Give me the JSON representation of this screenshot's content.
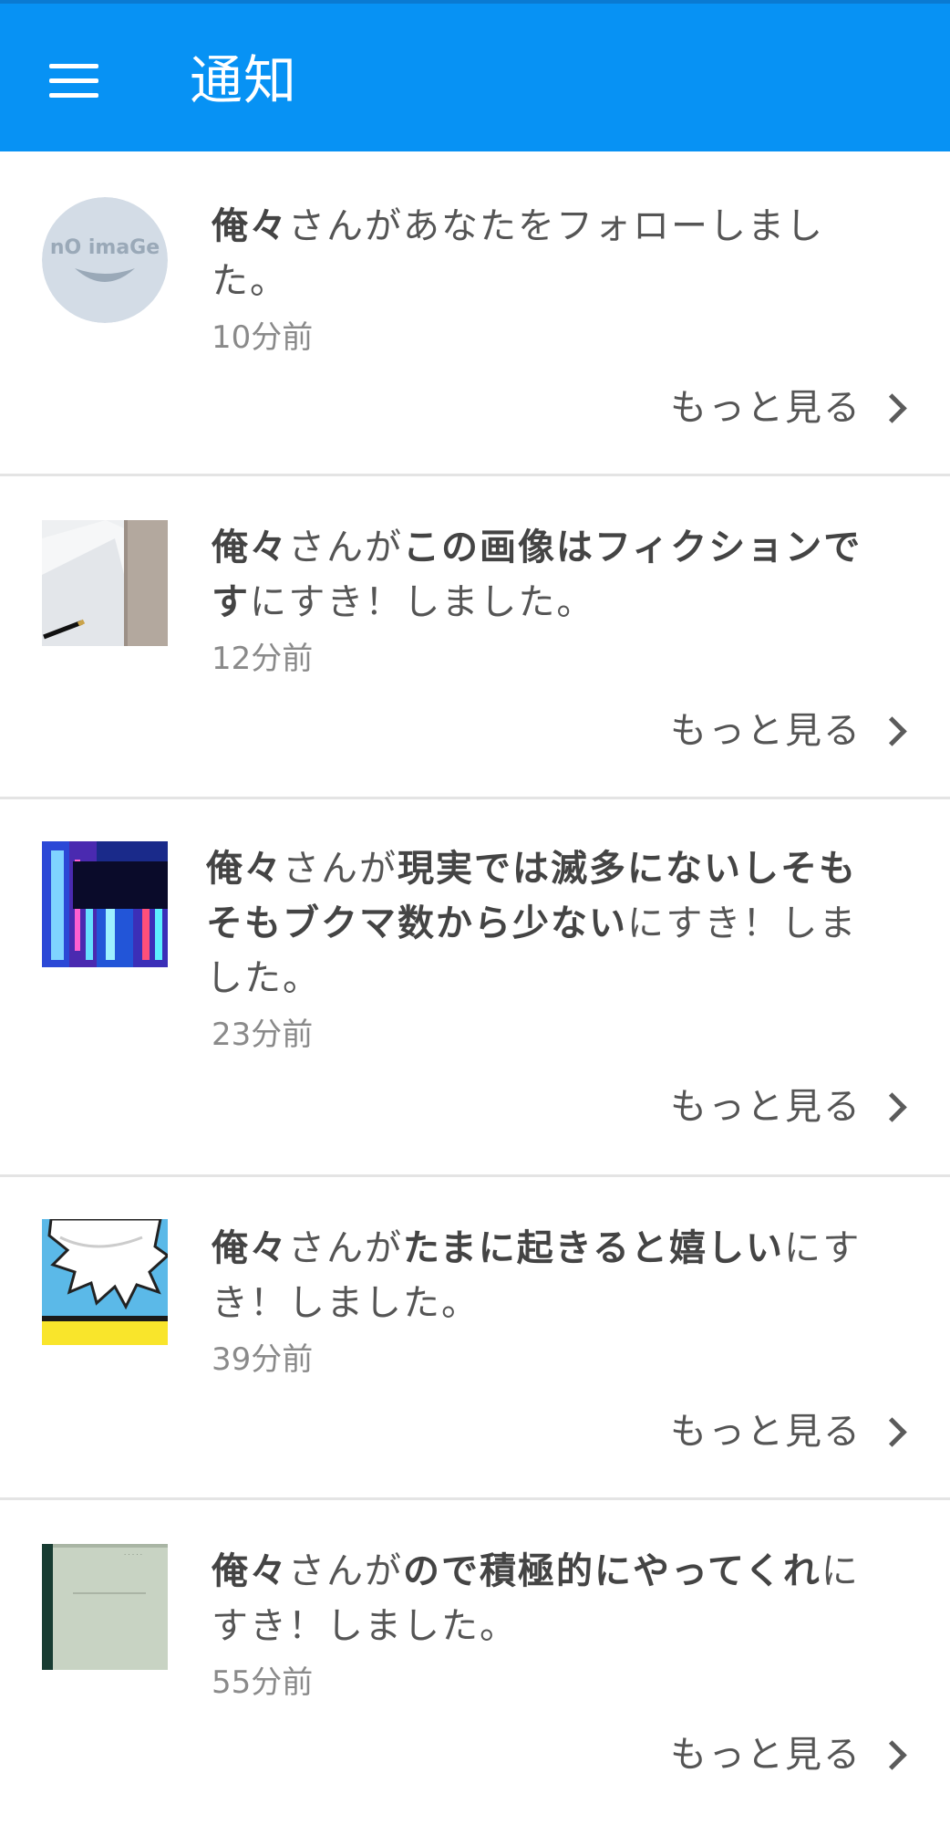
{
  "header": {
    "title": "通知",
    "menu_icon": "hamburger-menu-icon",
    "accent_color": "#0792f4"
  },
  "notifications": [
    {
      "user": "俺々",
      "mid": "さんがあなたをフォローしました。",
      "work": "",
      "suffix": "",
      "time": "10分前",
      "more": "もっと見る",
      "thumb": "no-image-avatar"
    },
    {
      "user": "俺々",
      "mid": "さんが",
      "work": "この画像はフィクションです",
      "suffix": "にすき！しました。",
      "time": "12分前",
      "more": "もっと見る",
      "thumb": "paper-and-pen-image"
    },
    {
      "user": "俺々",
      "mid": "さんが",
      "work": "現実では滅多にないしそもそもブクマ数から少ない",
      "suffix": "にすき！しました。",
      "time": "23分前",
      "more": "もっと見る",
      "thumb": "city-night-image"
    },
    {
      "user": "俺々",
      "mid": "さんが",
      "work": "たまに起きると嬉しい",
      "suffix": "にすき！しました。",
      "time": "39分前",
      "more": "もっと見る",
      "thumb": "comic-burst-image"
    },
    {
      "user": "俺々",
      "mid": "さんが",
      "work": "ので積極的にやってくれ",
      "suffix": "にすき！しました。",
      "time": "55分前",
      "more": "もっと見る",
      "thumb": "notebook-cover-image"
    }
  ]
}
